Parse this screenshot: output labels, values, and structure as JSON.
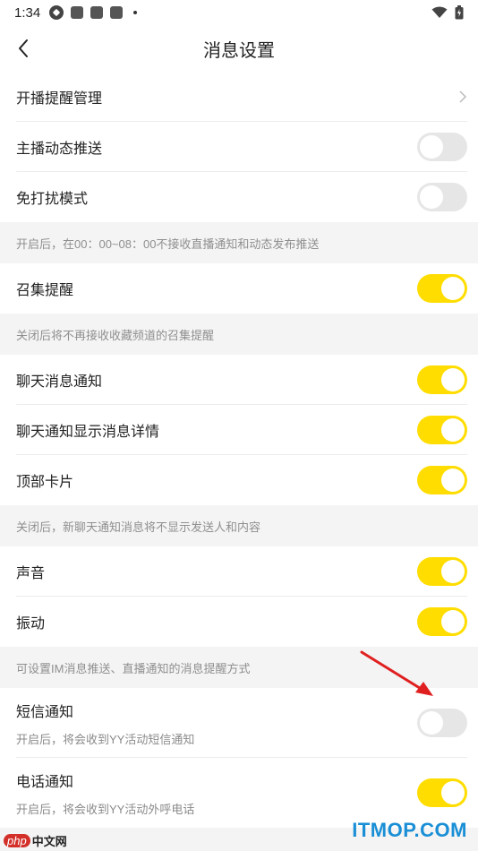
{
  "status": {
    "time": "1:34"
  },
  "nav": {
    "title": "消息设置"
  },
  "rows": {
    "live_reminder_label": "开播提醒管理",
    "anchor_push_label": "主播动态推送",
    "dnd_label": "免打扰模式",
    "dnd_note": "开启后，在00：00~08：00不接收直播通知和动态发布推送",
    "rally_label": "召集提醒",
    "rally_note": "关闭后将不再接收收藏频道的召集提醒",
    "chat_notify_label": "聊天消息通知",
    "chat_detail_label": "聊天通知显示消息详情",
    "top_card_label": "顶部卡片",
    "chat_note": "关闭后，新聊天通知消息将不显示发送人和内容",
    "sound_label": "声音",
    "vibrate_label": "振动",
    "sound_note": "可设置IM消息推送、直播通知的消息提醒方式",
    "sms_label": "短信通知",
    "sms_sub": "开启后，将会收到YY活动短信通知",
    "phone_label": "电话通知",
    "phone_sub": "开启后，将会收到YY活动外呼电话"
  },
  "toggles": {
    "anchor_push": false,
    "dnd": false,
    "rally": true,
    "chat_notify": true,
    "chat_detail": true,
    "top_card": true,
    "sound": true,
    "vibrate": true,
    "sms": false,
    "phone": true
  },
  "colors": {
    "toggle_on": "#ffdd00",
    "toggle_off": "#e6e6e6",
    "annotation_arrow": "#e02020"
  },
  "watermarks": {
    "itmop": "ITMOP.COM",
    "php_badge": "php",
    "php_text": "中文网"
  }
}
